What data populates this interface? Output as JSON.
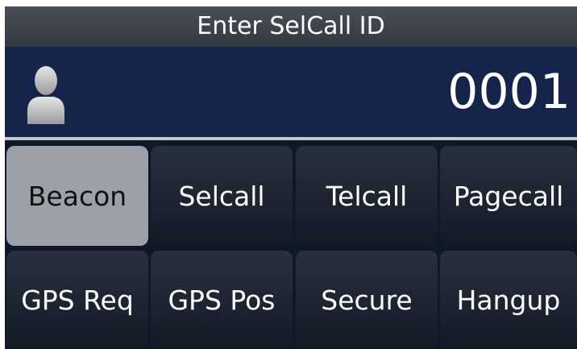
{
  "title": "Enter SelCall ID",
  "selcall_id": "0001",
  "buttons": {
    "beacon": "Beacon",
    "selcall": "Selcall",
    "telcall": "Telcall",
    "pagecall": "Pagecall",
    "gps_req": "GPS Req",
    "gps_pos": "GPS Pos",
    "secure": "Secure",
    "hangup": "Hangup"
  },
  "selected_button": "Beacon",
  "icons": {
    "contact": "user-icon"
  }
}
